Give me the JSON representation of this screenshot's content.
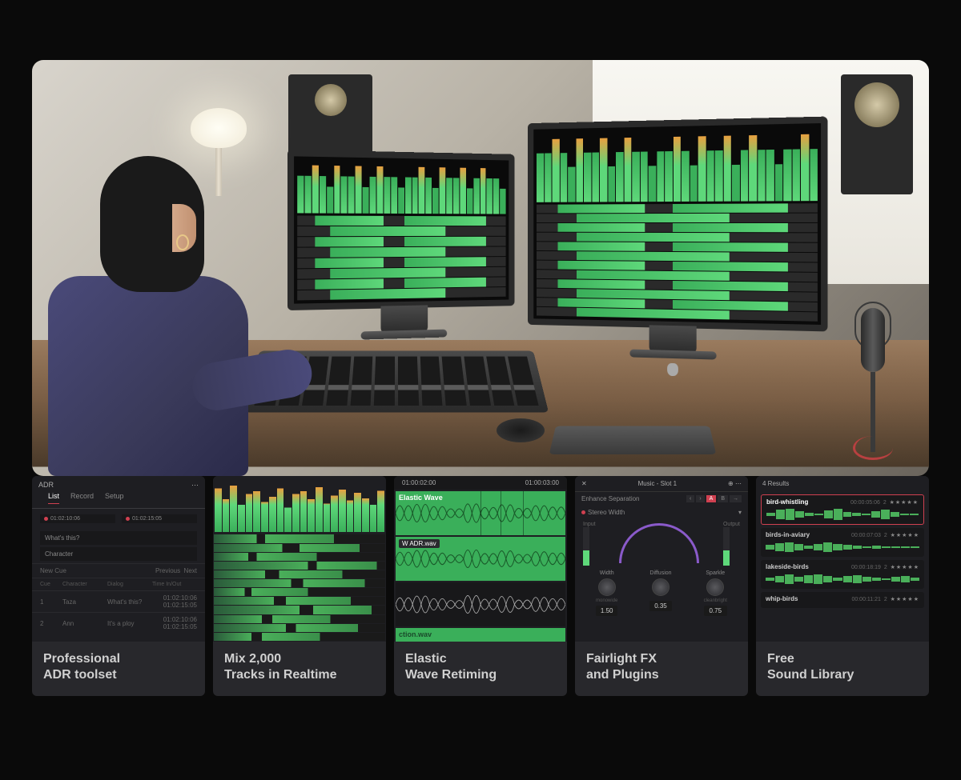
{
  "cards": [
    {
      "label": "Professional\nADR toolset",
      "adr": {
        "title": "ADR",
        "tabs": [
          "List",
          "Record",
          "Setup"
        ],
        "time_in": "01:02:10:06",
        "time_out": "01:02:15:05",
        "field_whats": "What's this?",
        "field_char": "Character",
        "new_cue": "New Cue",
        "prev": "Previous",
        "next": "Next",
        "headers": [
          "Cue",
          "Character",
          "Dialog",
          "Time In/Out"
        ],
        "rows": [
          {
            "cue": "1",
            "char": "Taza",
            "dialog": "What's this?",
            "in": "01:02:10:06",
            "out": "01:02:15:05"
          },
          {
            "cue": "2",
            "char": "Ann",
            "dialog": "It's a ploy",
            "in": "01:02:10:06",
            "out": "01:02:15:05"
          }
        ]
      }
    },
    {
      "label": "Mix 2,000\nTracks in Realtime"
    },
    {
      "label": "Elastic\nWave Retiming",
      "elastic": {
        "tc1": "01:00:02:00",
        "tc2": "01:00:03:00",
        "wave1": "Elastic Wave",
        "wave2": "ADR.wav",
        "wave3": "ction.wav"
      }
    },
    {
      "label": "Fairlight FX\nand Plugins",
      "fx": {
        "title": "Music - Slot 1",
        "preset": "Enhance Separation",
        "ab": [
          "A",
          "B"
        ],
        "section": "Stereo Width",
        "input": "Input",
        "output": "Output",
        "knobs": [
          {
            "name": "Width",
            "lo": "mono",
            "hi": "wide",
            "val": "1.50"
          },
          {
            "name": "Diffusion",
            "lo": "",
            "hi": "",
            "val": "0.35"
          },
          {
            "name": "Sparkle",
            "lo": "clean",
            "hi": "bright",
            "val": "0.75"
          }
        ]
      }
    },
    {
      "label": "Free\nSound Library",
      "lib": {
        "results": "4 Results",
        "items": [
          {
            "name": "bird-whistling",
            "dur": "00:00:05:06",
            "ch": "2"
          },
          {
            "name": "birds-in-aviary",
            "dur": "00:00:07:03",
            "ch": "2"
          },
          {
            "name": "lakeside-birds",
            "dur": "00:00:18:19",
            "ch": "2"
          },
          {
            "name": "whip-birds",
            "dur": "00:00:11:21",
            "ch": "2"
          }
        ]
      }
    }
  ]
}
